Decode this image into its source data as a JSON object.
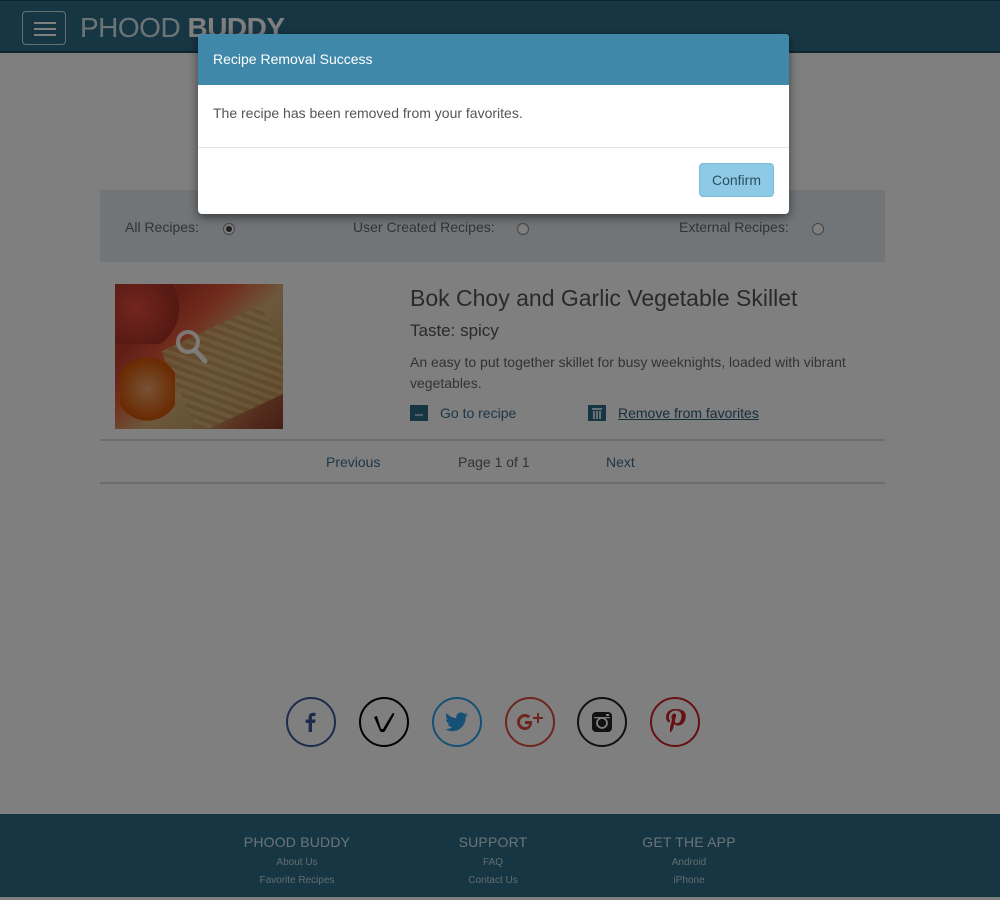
{
  "header": {
    "logo_light": "PHOOD ",
    "logo_bold": "BUDDY",
    "menu_icon": "hamburger-menu-icon"
  },
  "filters": {
    "all_label": "All Recipes:",
    "user_label": "User Created Recipes:",
    "external_label": "External Recipes:",
    "selected": "all"
  },
  "recipe": {
    "title": "Bok Choy and Garlic Vegetable Skillet",
    "taste": "Taste: spicy",
    "description": "An easy to put together skillet for busy weeknights, loaded with vibrant vegetables.",
    "goto_label": "Go to recipe",
    "goto_icon": "document-icon",
    "remove_label": "Remove from favorites",
    "remove_icon": "trash-icon"
  },
  "pager": {
    "previous": "Previous",
    "info": "Page 1 of 1",
    "next": "Next"
  },
  "social": [
    {
      "name": "facebook",
      "icon": "facebook-icon",
      "color": "#3b5998"
    },
    {
      "name": "vimeo",
      "icon": "vimeo-icon",
      "color": "#000000"
    },
    {
      "name": "twitter",
      "icon": "twitter-icon",
      "color": "#2aa3ef"
    },
    {
      "name": "google-plus",
      "icon": "google-plus-icon",
      "color": "#dd4b39"
    },
    {
      "name": "instagram",
      "icon": "instagram-icon",
      "color": "#222222"
    },
    {
      "name": "pinterest",
      "icon": "pinterest-icon",
      "color": "#cb2027"
    }
  ],
  "footer": {
    "col1": {
      "title": "PHOOD BUDDY",
      "links": [
        "About Us",
        "Favorite Recipes"
      ]
    },
    "col2": {
      "title": "SUPPORT",
      "links": [
        "FAQ",
        "Contact Us"
      ]
    },
    "col3": {
      "title": "GET THE APP",
      "links": [
        "Android",
        "iPhone"
      ]
    }
  },
  "modal": {
    "title": "Recipe Removal Success",
    "message": "The recipe has been removed from your favorites.",
    "confirm_label": "Confirm"
  },
  "colors": {
    "brand": "#2f6d89",
    "modal_header": "#3f88aa",
    "confirm_button": "#8ecae6"
  }
}
